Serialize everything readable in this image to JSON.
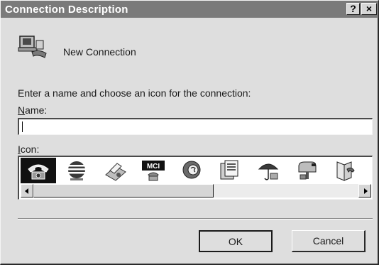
{
  "window": {
    "title": "Connection Description",
    "help_button": "?",
    "close_button": "×"
  },
  "connection": {
    "icon": "computer-phone-icon",
    "name": "New Connection"
  },
  "form": {
    "prompt": "Enter a name and choose an icon for the connection:",
    "name_label_mnemonic": "N",
    "name_label_rest": "ame:",
    "name_value": "",
    "icon_label_mnemonic": "I",
    "icon_label_rest": "con:"
  },
  "icons": [
    {
      "name": "telephone-icon",
      "selected": true
    },
    {
      "name": "globe-network-icon",
      "selected": false
    },
    {
      "name": "fax-machine-icon",
      "selected": false
    },
    {
      "name": "mci-logo-icon",
      "text": "MCI",
      "selected": false
    },
    {
      "name": "ge-globe-icon",
      "selected": false
    },
    {
      "name": "documents-icon",
      "selected": false
    },
    {
      "name": "umbrella-icon",
      "selected": false
    },
    {
      "name": "mailbox-icon",
      "selected": false
    },
    {
      "name": "book-phone-icon",
      "selected": false
    }
  ],
  "buttons": {
    "ok": "OK",
    "cancel": "Cancel"
  },
  "colors": {
    "titlebar": "#7a7a7a",
    "dialog_bg": "#dedede",
    "selection": "#111111"
  }
}
